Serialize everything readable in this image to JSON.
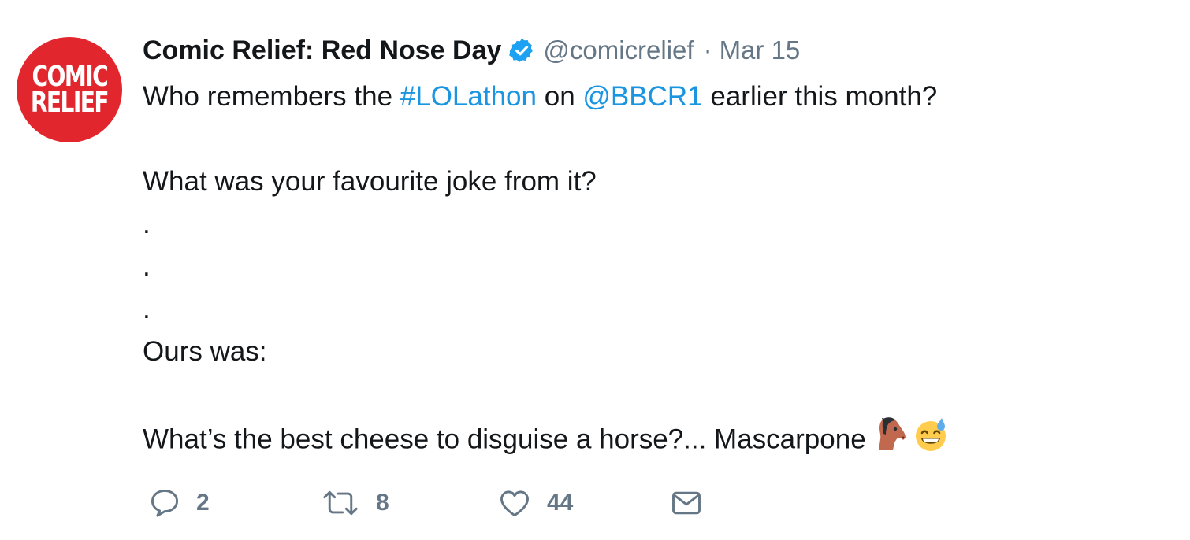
{
  "tweet": {
    "avatar_text": [
      "COMIC",
      "RELIEF"
    ],
    "display_name": "Comic Relief: Red Nose Day",
    "verified": true,
    "handle": "@comicrelief",
    "separator": "·",
    "date": "Mar 15",
    "body": {
      "line1": {
        "pre": "Who remembers the ",
        "hashtag": "#LOLathon",
        "mid": " on ",
        "mention": "@BBCR1",
        "post": " earlier this month?"
      },
      "line2": "What was your favourite joke from it?",
      "dots": [
        ".",
        ".",
        "."
      ],
      "line3": "Ours was:",
      "line4": "What’s the best cheese to disguise a horse?... Mascarpone",
      "emojis": [
        "horse-face",
        "grinning-sweat"
      ]
    },
    "actions": {
      "reply_count": "2",
      "retweet_count": "8",
      "like_count": "44"
    }
  },
  "colors": {
    "link": "#1b95e0",
    "secondary_text": "#657786",
    "verified_badge": "#1da1f2",
    "avatar_bg": "#e1262d"
  }
}
